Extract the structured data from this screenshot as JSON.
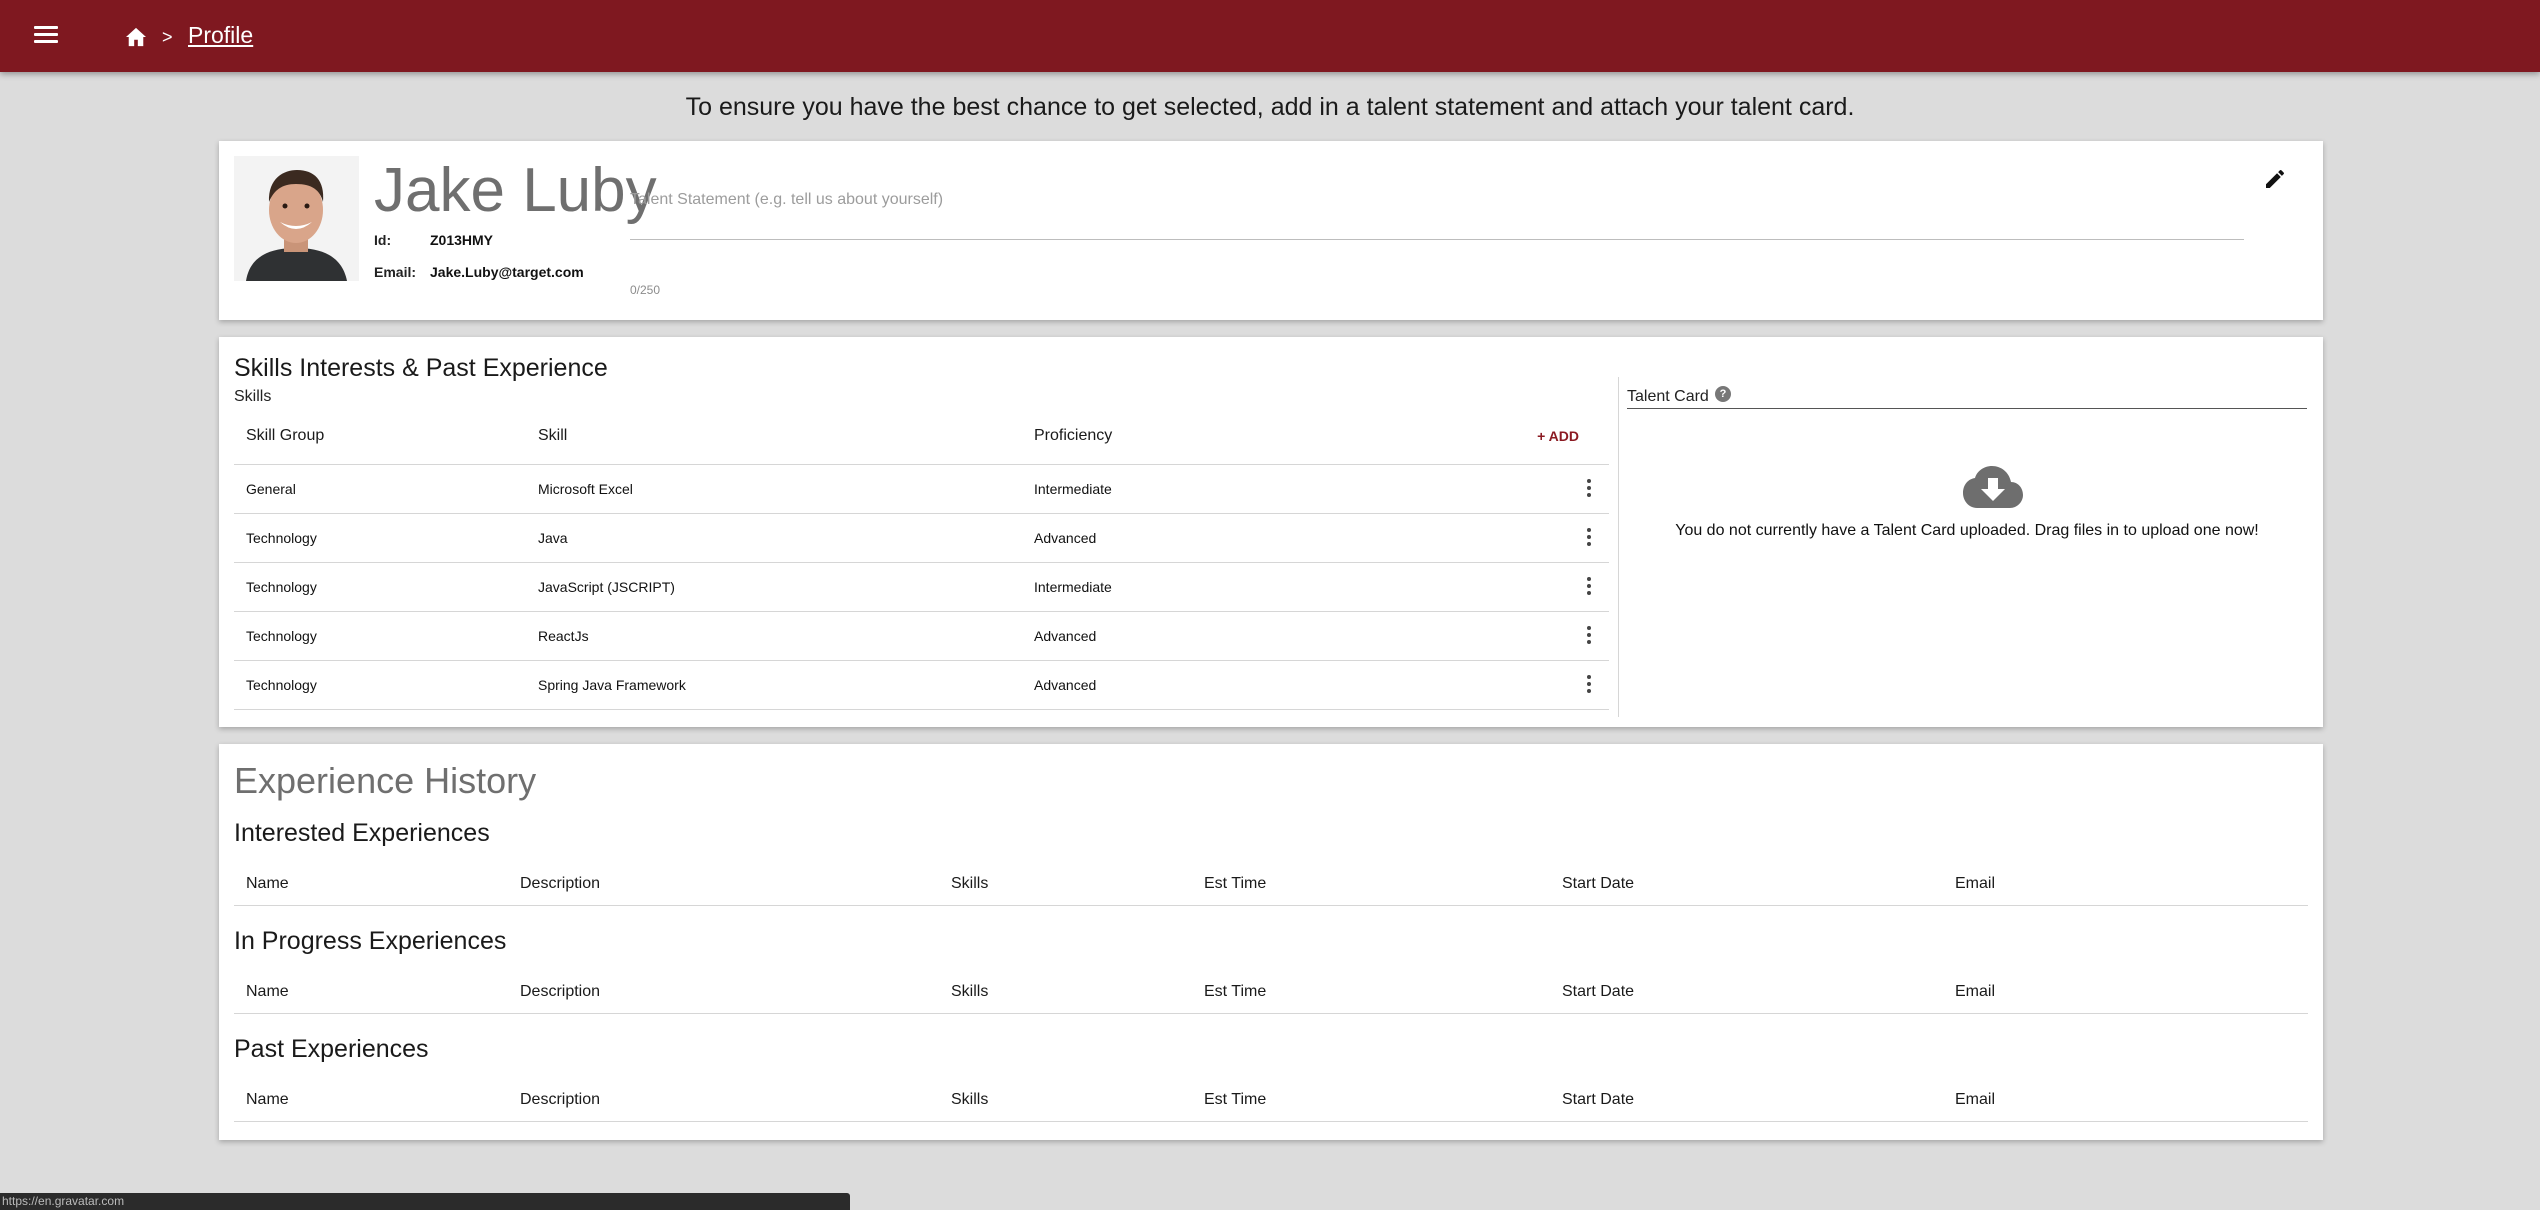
{
  "breadcrumb": {
    "separator": ">",
    "current": "Profile"
  },
  "notice": "To ensure you have the best chance to get selected, add in a talent statement and attach your talent card.",
  "profile": {
    "name": "Jake Luby",
    "id_label": "Id:",
    "id_value": "Z013HMY",
    "email_label": "Email:",
    "email_value": "Jake.Luby@target.com",
    "talent_placeholder": "Talent Statement (e.g. tell us about yourself)",
    "char_count": "0/250"
  },
  "skills_section": {
    "title": "Skills Interests & Past Experience",
    "subtitle": "Skills",
    "columns": [
      "Skill Group",
      "Skill",
      "Proficiency"
    ],
    "add_label": "+ ADD",
    "rows": [
      {
        "group": "General",
        "skill": "Microsoft Excel",
        "proficiency": "Intermediate"
      },
      {
        "group": "Technology",
        "skill": "Java",
        "proficiency": "Advanced"
      },
      {
        "group": "Technology",
        "skill": "JavaScript (JSCRIPT)",
        "proficiency": "Intermediate"
      },
      {
        "group": "Technology",
        "skill": "ReactJs",
        "proficiency": "Advanced"
      },
      {
        "group": "Technology",
        "skill": "Spring Java Framework",
        "proficiency": "Advanced"
      }
    ]
  },
  "talent_card": {
    "label": "Talent Card",
    "help": "?",
    "message": "You do not currently have a Talent Card uploaded. Drag files in to upload one now!"
  },
  "experience": {
    "title": "Experience History",
    "columns": [
      "Name",
      "Description",
      "Skills",
      "Est Time",
      "Start Date",
      "Email"
    ],
    "sections": [
      {
        "title": "Interested Experiences"
      },
      {
        "title": "In Progress Experiences"
      },
      {
        "title": "Past Experiences"
      }
    ]
  },
  "status_url": "https://en.gravatar.com",
  "colors": {
    "header": "#7f1820",
    "accent": "#8b1a22",
    "background": "#dcdcdc"
  }
}
